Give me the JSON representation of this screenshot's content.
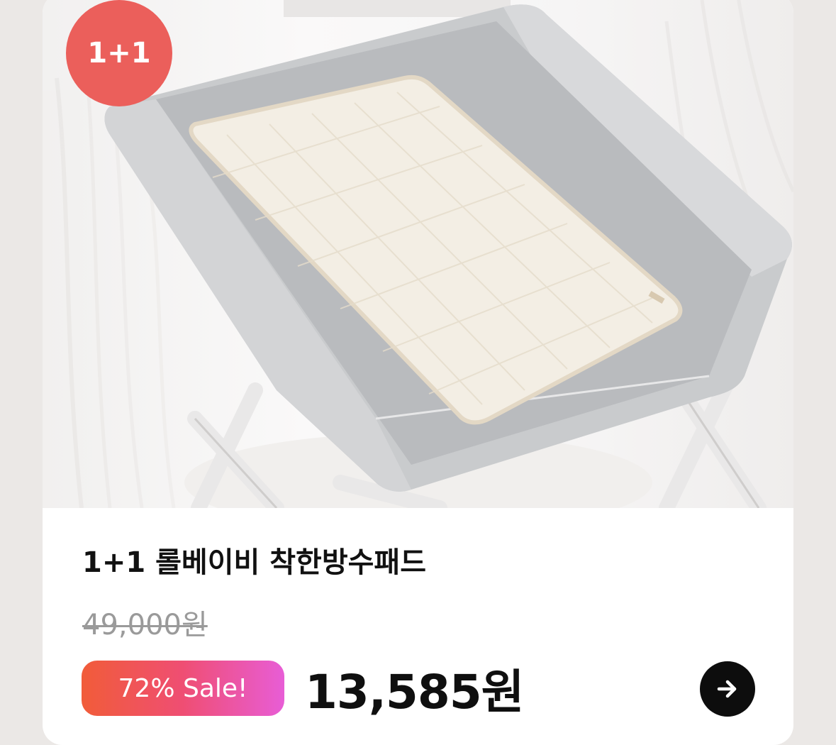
{
  "product": {
    "badge": "1+1",
    "title": "1+1 롤베이비 착한방수패드",
    "original_price": "49,000원",
    "sale_badge": "72% Sale!",
    "sale_price": "13,585원",
    "image_icon": "product-photo-changing-pad",
    "go_icon": "arrow-right-icon"
  },
  "colors": {
    "badge_red": "#eb5f5b",
    "sale_gradient_start": "#f15c39",
    "sale_gradient_end": "#e85dd6",
    "price_strike": "#9a9a9a",
    "button_dark": "#0d0d0d"
  }
}
